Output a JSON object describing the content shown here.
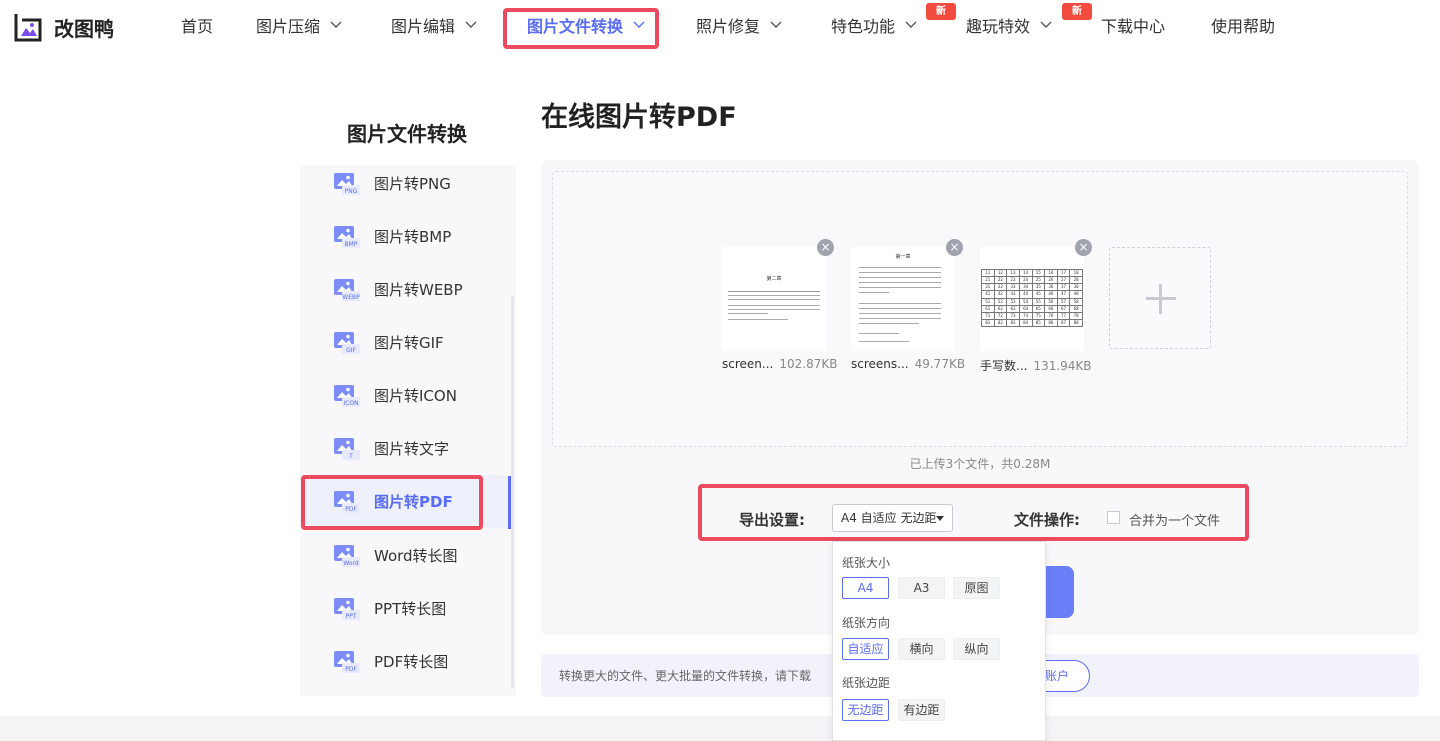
{
  "brand": {
    "name": "改图鸭",
    "logo": "duck-photo-logo-icon"
  },
  "nav": {
    "items": [
      {
        "label": "首页",
        "dropdown": false
      },
      {
        "label": "图片压缩",
        "dropdown": true
      },
      {
        "label": "图片编辑",
        "dropdown": true
      },
      {
        "label": "图片文件转换",
        "dropdown": true,
        "active": true
      },
      {
        "label": "照片修复",
        "dropdown": true
      },
      {
        "label": "特色功能",
        "dropdown": true,
        "badge": "新"
      },
      {
        "label": "趣玩特效",
        "dropdown": true,
        "badge": "新"
      },
      {
        "label": "下载中心",
        "dropdown": false
      },
      {
        "label": "使用帮助",
        "dropdown": false
      }
    ]
  },
  "sidebar": {
    "title": "图片文件转换",
    "items": [
      {
        "label": "图片转PNG",
        "icon": "image-png-icon",
        "tag": "PNG"
      },
      {
        "label": "图片转BMP",
        "icon": "image-bmp-icon",
        "tag": "BMP"
      },
      {
        "label": "图片转WEBP",
        "icon": "image-webp-icon",
        "tag": "WEBP"
      },
      {
        "label": "图片转GIF",
        "icon": "image-gif-icon",
        "tag": "GIF"
      },
      {
        "label": "图片转ICON",
        "icon": "image-icon-icon",
        "tag": "ICON"
      },
      {
        "label": "图片转文字",
        "icon": "image-text-icon",
        "tag": "T"
      },
      {
        "label": "图片转PDF",
        "icon": "image-pdf-icon",
        "tag": "PDF",
        "active": true
      },
      {
        "label": "Word转长图",
        "icon": "word-long-image-icon",
        "tag": "Word"
      },
      {
        "label": "PPT转长图",
        "icon": "ppt-long-image-icon",
        "tag": "PPT"
      },
      {
        "label": "PDF转长图",
        "icon": "pdf-long-image-icon",
        "tag": "PDF"
      }
    ]
  },
  "main": {
    "title": "在线图片转PDF",
    "files": [
      {
        "name": "screen...",
        "size": "102.87KB",
        "doc_heading": "第二章"
      },
      {
        "name": "screens...",
        "size": "49.77KB",
        "doc_heading": "第一章"
      },
      {
        "name": "手写数...",
        "size": "131.94KB"
      }
    ],
    "upload_status": "已上传3个文件，共0.28M",
    "export_label": "导出设置:",
    "export_value": "A4 自适应 无边距",
    "file_op_label": "文件操作:",
    "merge_label": "合并为一个文件",
    "merge_checked": false,
    "promo_text": "转换更大的文件、更大批量的文件转换，请下载",
    "promo_button_partial": "账户"
  },
  "dropdown": {
    "paper_size": {
      "label": "纸张大小",
      "options": [
        "A4",
        "A3",
        "原图"
      ],
      "selected": "A4"
    },
    "orientation": {
      "label": "纸张方向",
      "options": [
        "自适应",
        "横向",
        "纵向"
      ],
      "selected": "自适应"
    },
    "margin": {
      "label": "纸张边距",
      "options": [
        "无边距",
        "有边距"
      ],
      "selected": "无边距"
    }
  },
  "grid_numbers": [
    [
      "11",
      "12",
      "13",
      "14",
      "15",
      "16",
      "17",
      "18"
    ],
    [
      "21",
      "22",
      "23",
      "24",
      "25",
      "26",
      "27",
      "28"
    ],
    [
      "31",
      "32",
      "33",
      "34",
      "35",
      "36",
      "37",
      "38"
    ],
    [
      "41",
      "42",
      "43",
      "44",
      "45",
      "46",
      "47",
      "48"
    ],
    [
      "51",
      "52",
      "53",
      "54",
      "55",
      "56",
      "57",
      "58"
    ],
    [
      "61",
      "62",
      "63",
      "64",
      "65",
      "66",
      "67",
      "68"
    ],
    [
      "71",
      "72",
      "73",
      "74",
      "75",
      "76",
      "77",
      "78"
    ],
    [
      "81",
      "82",
      "83",
      "84",
      "85",
      "86",
      "87",
      "88"
    ]
  ],
  "colors": {
    "accent": "#5b6cf5",
    "highlight": "#ec4a5f",
    "badge": "#f24b3f"
  }
}
